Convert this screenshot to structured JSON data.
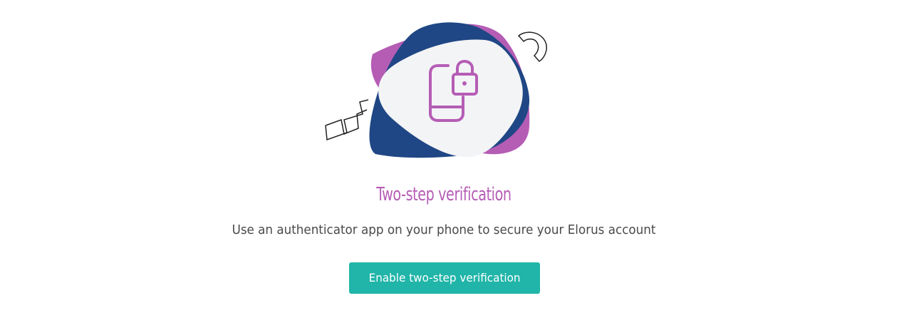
{
  "title": "Two-step verification",
  "subtitle": "Use an authenticator app on your phone to secure your Elorus account",
  "enable_button_label": "Enable two-step verification",
  "illustration": {
    "icon": "phone-lock-icon",
    "colors": {
      "purple": "#b55db5",
      "navy": "#1f4785",
      "light": "#f3f4f6",
      "outline": "#222222"
    }
  },
  "colors": {
    "title": "#b55db5",
    "text": "#4a4a4a",
    "button": "#20b5a8",
    "button_text": "#ffffff"
  }
}
